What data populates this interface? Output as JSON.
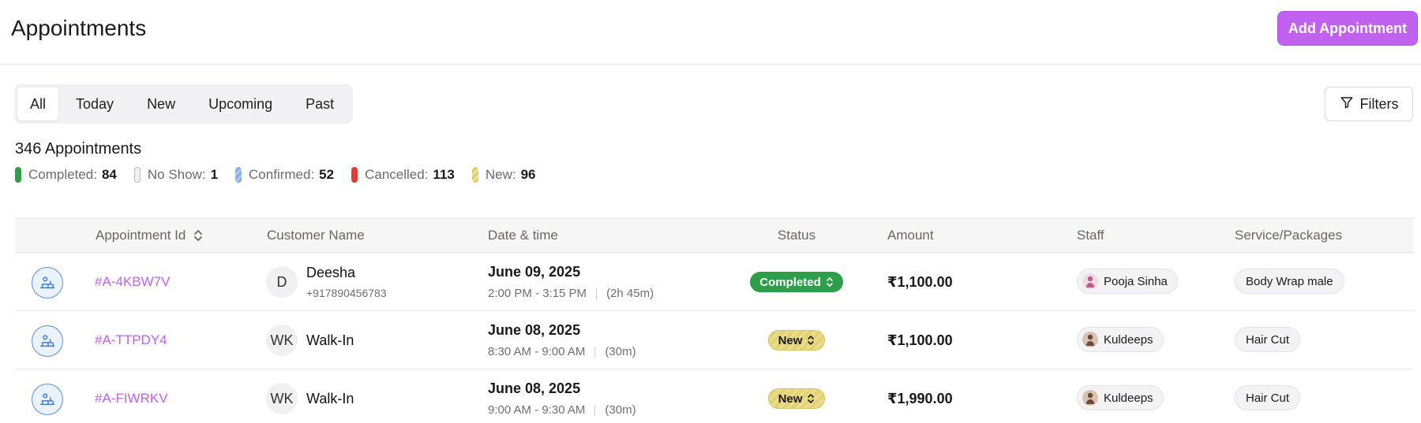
{
  "header": {
    "title": "Appointments",
    "add_button": "Add Appointment"
  },
  "tabs": [
    {
      "label": "All",
      "active": true
    },
    {
      "label": "Today",
      "active": false
    },
    {
      "label": "New",
      "active": false
    },
    {
      "label": "Upcoming",
      "active": false
    },
    {
      "label": "Past",
      "active": false
    }
  ],
  "filters_label": "Filters",
  "summary": {
    "count_text": "346 Appointments"
  },
  "legend": [
    {
      "label": "Completed:",
      "value": "84",
      "color": "#2f9e4b"
    },
    {
      "label": "No Show:",
      "value": "1",
      "color": "#e8e8ec"
    },
    {
      "label": "Confirmed:",
      "value": "52",
      "color": "#8fb8ee"
    },
    {
      "label": "Cancelled:",
      "value": "113",
      "color": "#e53935"
    },
    {
      "label": "New:",
      "value": "96",
      "color": "#e6d67a"
    }
  ],
  "table": {
    "headers": {
      "id": "Appointment Id",
      "customer": "Customer Name",
      "datetime": "Date & time",
      "status": "Status",
      "amount": "Amount",
      "staff": "Staff",
      "service": "Service/Packages"
    },
    "rows": [
      {
        "id": "#A-4KBW7V",
        "avatar": "D",
        "customer": "Deesha",
        "phone": "+917890456783",
        "date": "June 09, 2025",
        "time": "2:00 PM - 3:15 PM",
        "duration": "(2h 45m)",
        "status": "Completed",
        "amount": "₹1,100.00",
        "staff": "Pooja Sinha",
        "service": "Body Wrap male"
      },
      {
        "id": "#A-TTPDY4",
        "avatar": "WK",
        "customer": "Walk-In",
        "phone": "",
        "date": "June 08, 2025",
        "time": "8:30 AM - 9:00 AM",
        "duration": "(30m)",
        "status": "New",
        "amount": "₹1,100.00",
        "staff": "Kuldeeps",
        "service": "Hair Cut"
      },
      {
        "id": "#A-FIWRKV",
        "avatar": "WK",
        "customer": "Walk-In",
        "phone": "",
        "date": "June 08, 2025",
        "time": "9:00 AM - 9:30 AM",
        "duration": "(30m)",
        "status": "New",
        "amount": "₹1,990.00",
        "staff": "Kuldeeps",
        "service": "Hair Cut"
      }
    ]
  },
  "colors": {
    "accent": "#c061f0",
    "completed": "#2f9e4b",
    "new": "#e6d67a",
    "icon_blue": "#5c8fd8"
  }
}
